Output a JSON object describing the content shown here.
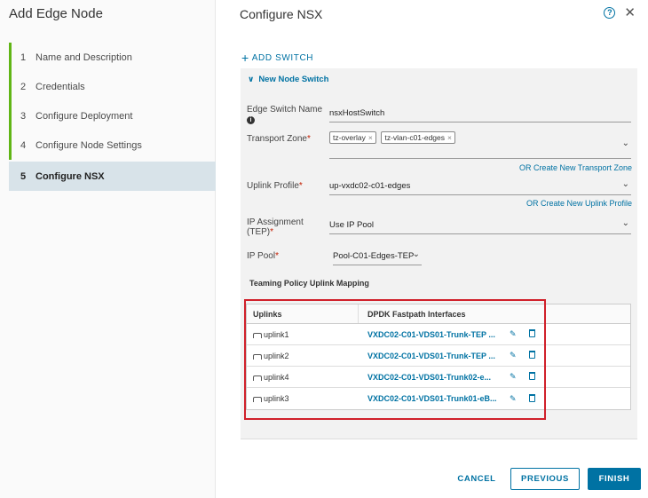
{
  "wizard": {
    "title": "Add Edge Node",
    "steps": [
      {
        "num": "1",
        "label": "Name and Description"
      },
      {
        "num": "2",
        "label": "Credentials"
      },
      {
        "num": "3",
        "label": "Configure Deployment"
      },
      {
        "num": "4",
        "label": "Configure Node Settings"
      },
      {
        "num": "5",
        "label": "Configure NSX"
      }
    ]
  },
  "header": {
    "title": "Configure NSX",
    "help_icon": "help-circle-icon",
    "close_icon": "close-icon"
  },
  "add_switch_label": "ADD SWITCH",
  "node_switch": {
    "title": "New Node Switch",
    "edge_switch_name_label": "Edge Switch Name",
    "edge_switch_name_value": "nsxHostSwitch",
    "transport_zone_label": "Transport Zone",
    "transport_zones": [
      "tz-overlay",
      "tz-vlan-c01-edges"
    ],
    "create_transport_zone_link": "OR Create New Transport Zone",
    "uplink_profile_label": "Uplink Profile",
    "uplink_profile_value": "up-vxdc02-c01-edges",
    "create_uplink_profile_link": "OR Create New Uplink Profile",
    "ip_assignment_label": "IP Assignment (TEP)",
    "ip_assignment_value": "Use IP Pool",
    "ip_pool_label": "IP Pool",
    "ip_pool_value": "Pool-C01-Edges-TEP",
    "teaming_title": "Teaming Policy Uplink Mapping",
    "columns": [
      "Uplinks",
      "DPDK Fastpath Interfaces"
    ],
    "rows": [
      {
        "uplink": "uplink1",
        "interface": "VXDC02-C01-VDS01-Trunk-TEP ..."
      },
      {
        "uplink": "uplink2",
        "interface": "VXDC02-C01-VDS01-Trunk-TEP ..."
      },
      {
        "uplink": "uplink4",
        "interface": "VXDC02-C01-VDS01-Trunk02-e..."
      },
      {
        "uplink": "uplink3",
        "interface": "VXDC02-C01-VDS01-Trunk01-eB..."
      }
    ]
  },
  "footer": {
    "cancel": "CANCEL",
    "previous": "PREVIOUS",
    "finish": "FINISH"
  },
  "colors": {
    "accent": "#0072a3",
    "step_done": "#60b515",
    "required": "#c21d00",
    "highlight_box": "#d0202a"
  }
}
